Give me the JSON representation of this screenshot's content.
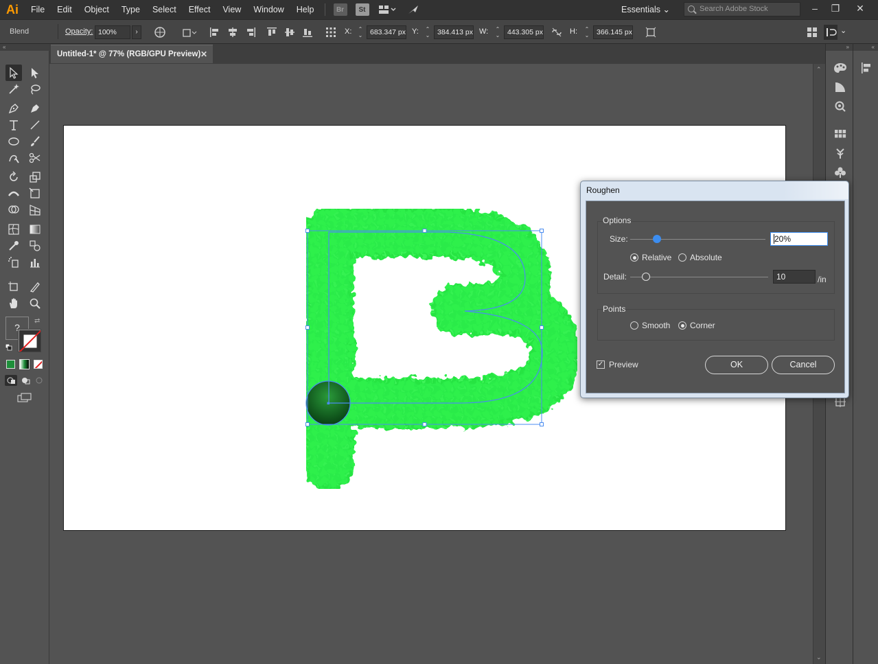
{
  "app": {
    "logo": "Ai"
  },
  "menu": [
    "File",
    "Edit",
    "Object",
    "Type",
    "Select",
    "Effect",
    "View",
    "Window",
    "Help"
  ],
  "menu_icons": {
    "bridge": "Br",
    "stock": "St"
  },
  "workspace": {
    "label": "Essentials"
  },
  "search": {
    "placeholder": "Search Adobe Stock"
  },
  "controlbar": {
    "selection_label": "Blend",
    "opacity_label": "Opacity:",
    "opacity_value": "100%",
    "x_label": "X:",
    "x_value": "683.347 px",
    "y_label": "Y:",
    "y_value": "384.413 px",
    "w_label": "W:",
    "w_value": "443.305 px",
    "h_label": "H:",
    "h_value": "366.145 px"
  },
  "document": {
    "tab_title": "Untitled-1* @ 77% (RGB/GPU Preview)"
  },
  "dialog": {
    "title": "Roughen",
    "options_label": "Options",
    "size_label": "Size:",
    "size_value": "20%",
    "size_fraction": 0.2,
    "relative_label": "Relative",
    "absolute_label": "Absolute",
    "detail_label": "Detail:",
    "detail_value": "10",
    "detail_unit": "/in",
    "points_label": "Points",
    "smooth_label": "Smooth",
    "corner_label": "Corner",
    "preview_label": "Preview",
    "ok_label": "OK",
    "cancel_label": "Cancel",
    "mode_selected": "Relative",
    "points_selected": "Corner",
    "preview_checked": true
  },
  "colors": {
    "accent": "#3c8df0",
    "letter_fill": "#2df24a",
    "letter_dark": "#0e8a22",
    "selection": "#4a8cf0"
  }
}
